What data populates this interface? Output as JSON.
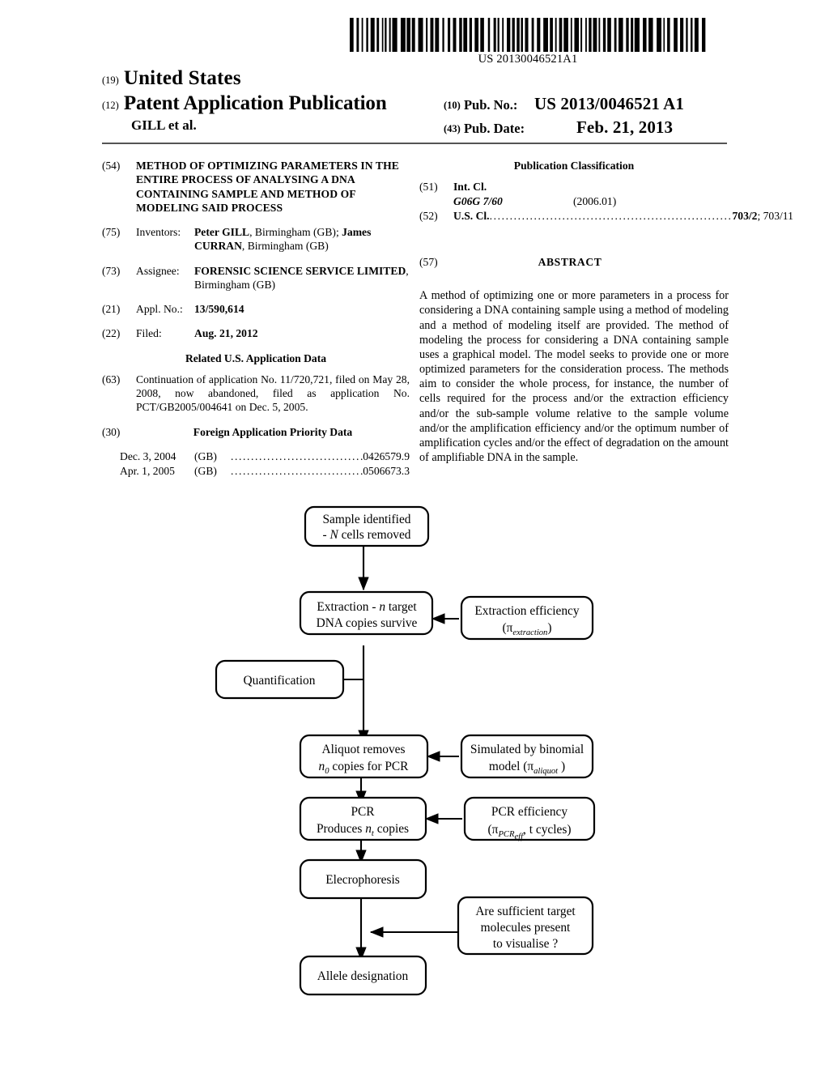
{
  "document": {
    "barcode_number": "US 20130046521A1",
    "kind": "patent-application-publication-front-page"
  },
  "header": {
    "code_19": "(19)",
    "country": "United States",
    "code_12": "(12)",
    "doc_type": "Patent Application Publication",
    "authors": "GILL et al.",
    "pub_no_code": "(10)",
    "pub_no_label": "Pub. No.:",
    "pub_no_value": "US 2013/0046521 A1",
    "pub_date_code": "(43)",
    "pub_date_label": "Pub. Date:",
    "pub_date_value": "Feb. 21, 2013"
  },
  "left_column": {
    "title_field": {
      "code": "(54)",
      "text": "METHOD OF OPTIMIZING PARAMETERS IN THE ENTIRE PROCESS OF ANALYSING A DNA CONTAINING SAMPLE AND METHOD OF MODELING SAID PROCESS"
    },
    "inventors_field": {
      "code": "(75)",
      "label": "Inventors:",
      "name_1": "Peter GILL",
      "loc_1": ", Birmingham (GB); ",
      "name_2": "James CURRAN",
      "loc_2": ", Birmingham (GB)"
    },
    "assignee_field": {
      "code": "(73)",
      "label": "Assignee:",
      "name": "FORENSIC SCIENCE SERVICE LIMITED",
      "location": ", Birmingham (GB)"
    },
    "appl_no_field": {
      "code": "(21)",
      "label": "Appl. No.:",
      "value": "13/590,614"
    },
    "filed_field": {
      "code": "(22)",
      "label": "Filed:",
      "value": "Aug. 21, 2012"
    },
    "related_heading": "Related U.S. Application Data",
    "continuation_field": {
      "code": "(63)",
      "text": "Continuation of application No. 11/720,721, filed on May 28, 2008, now abandoned, filed as application No. PCT/GB2005/004641 on Dec. 5, 2005."
    },
    "foreign_priority": {
      "code": "(30)",
      "heading": "Foreign Application Priority Data",
      "rows": [
        {
          "date": "Dec. 3, 2004",
          "country": "(GB)",
          "number": "0426579.9"
        },
        {
          "date": "Apr. 1, 2005",
          "country": "(GB)",
          "number": "0506673.3"
        }
      ]
    }
  },
  "right_column": {
    "classification_heading": "Publication Classification",
    "int_cl": {
      "code": "(51)",
      "label": "Int. Cl.",
      "symbol": "G06G 7/60",
      "version": "(2006.01)"
    },
    "us_cl": {
      "code": "(52)",
      "label": "U.S. Cl.",
      "primary": "703/2",
      "secondary": "; 703/11"
    },
    "abstract": {
      "code": "(57)",
      "heading": "ABSTRACT",
      "text": "A method of optimizing one or more parameters in a process for considering a DNA containing sample using a method of modeling and a method of modeling itself are provided. The method of modeling the process for considering a DNA containing sample uses a graphical model. The model seeks to provide one or more optimized parameters for the consideration process. The methods aim to consider the whole process, for instance, the number of cells required for the process and/or the extraction efficiency and/or the sub-sample volume relative to the sample volume and/or the amplification efficiency and/or the optimum number of amplification cycles and/or the effect of degradation on the amount of amplifiable DNA in the sample."
    }
  },
  "flowchart": {
    "nodes": [
      {
        "id": "sample",
        "line1": "Sample identified",
        "line2_pre": "- ",
        "line2_italic": "N",
        "line2_post": " cells removed"
      },
      {
        "id": "extraction",
        "line1_pre": "Extraction - ",
        "line1_italic": "n",
        "line1_post": " target",
        "line2": "DNA copies survive"
      },
      {
        "id": "extraction-eff",
        "line1": "Extraction efficiency",
        "line2_pre": "(π",
        "line2_sub": "extraction",
        "line2_post": ")"
      },
      {
        "id": "quantification",
        "line1": "Quantification"
      },
      {
        "id": "aliquot",
        "line1": "Aliquot removes",
        "line2_pre": "",
        "line2_italic": "n",
        "line2_sub": "0",
        "line2_post": " copies for PCR"
      },
      {
        "id": "binomial",
        "line1": "Simulated by binomial",
        "line2_pre": "model (π",
        "line2_sub": "aliquot",
        "line2_post": " )"
      },
      {
        "id": "pcr",
        "line1": "PCR",
        "line2_pre": "Produces ",
        "line2_italic": "n",
        "line2_sub": "t",
        "line2_post": " copies"
      },
      {
        "id": "pcr-eff",
        "line1": "PCR efficiency",
        "line2_pre": "(π",
        "line2_sub": "PCR",
        "line2_sub2": "eff",
        "line2_post": ", t cycles)"
      },
      {
        "id": "electrophoresis",
        "line1": "Elecrophoresis"
      },
      {
        "id": "sufficient",
        "line1": "Are sufficient target",
        "line2": "molecules present",
        "line3": "to visualise ?"
      },
      {
        "id": "allele",
        "line1": "Allele designation"
      }
    ]
  }
}
